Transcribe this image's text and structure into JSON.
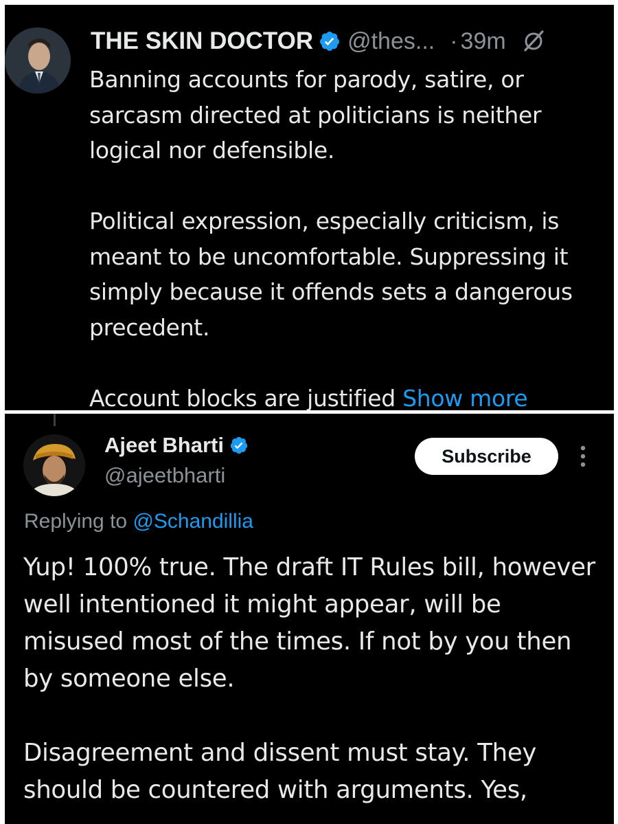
{
  "tweet_top": {
    "author_name": "THE SKIN DOCTOR",
    "handle": "@thes...",
    "separator": "·",
    "time": "39m",
    "paragraphs": [
      "Banning accounts for parody, satire, or sarcasm directed at politicians is neither logical nor defensible.",
      "Political expression, especially criticism, is meant to be uncomfortable. Suppressing it simply because it offends sets a dangerous precedent."
    ],
    "last_paragraph": "Account blocks are justified",
    "show_more": "Show more"
  },
  "tweet_bottom": {
    "author_name": "Ajeet Bharti",
    "handle": "@ajeetbharti",
    "subscribe_label": "Subscribe",
    "replying_prefix": "Replying to",
    "replying_mention": "@Schandillia",
    "paragraphs": [
      "Yup! 100% true. The draft IT Rules bill, however well intentioned it might appear, will be misused most of the times. If not by you then by someone else.",
      "Disagreement and dissent must stay. They should be countered with arguments. Yes,"
    ]
  },
  "colors": {
    "background": "#000000",
    "text": "#e7e9ea",
    "muted": "#8b9298",
    "link": "#1d9bf0",
    "verified": "#1d9bf0"
  },
  "icons": {
    "verified": "verified-badge-icon",
    "grok": "grok-icon",
    "more": "more-vertical-icon"
  }
}
